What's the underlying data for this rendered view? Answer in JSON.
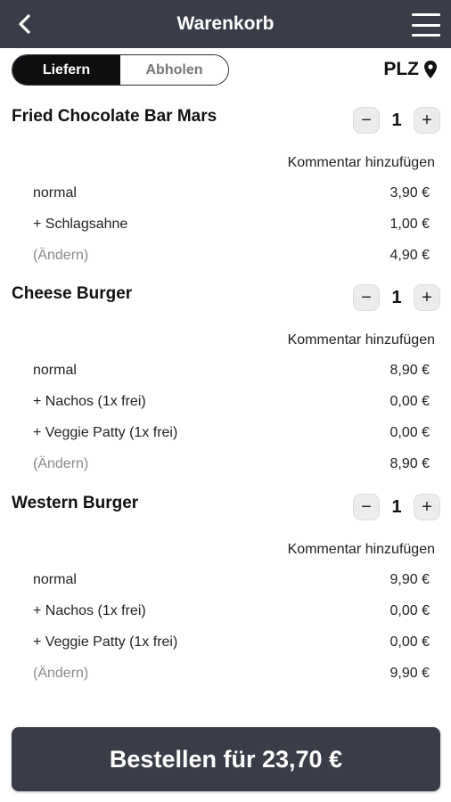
{
  "header": {
    "title": "Warenkorb",
    "back_icon": "chevron-left-icon",
    "menu_icon": "hamburger-menu-icon"
  },
  "delivery_toggle": {
    "options": [
      "Liefern",
      "Abholen"
    ],
    "selected": "Liefern"
  },
  "plz": {
    "label": "PLZ",
    "icon": "location-pin-icon"
  },
  "items": [
    {
      "name": "Fried Chocolate Bar Mars",
      "quantity": "1",
      "comment_label": "Kommentar hinzufügen",
      "lines": [
        {
          "label": "normal",
          "price": "3,90 €"
        },
        {
          "label": "+ Schlagsahne",
          "price": "1,00 €"
        },
        {
          "label": "(Ändern)",
          "price": "4,90 €"
        }
      ]
    },
    {
      "name": "Cheese Burger",
      "quantity": "1",
      "comment_label": "Kommentar hinzufügen",
      "lines": [
        {
          "label": "normal",
          "price": "8,90 €"
        },
        {
          "label": "+ Nachos (1x frei)",
          "price": "0,00 €"
        },
        {
          "label": "+ Veggie Patty (1x frei)",
          "price": "0,00 €"
        },
        {
          "label": "(Ändern)",
          "price": "8,90 €"
        }
      ]
    },
    {
      "name": "Western Burger",
      "quantity": "1",
      "comment_label": "Kommentar hinzufügen",
      "lines": [
        {
          "label": "normal",
          "price": "9,90 €"
        },
        {
          "label": "+ Nachos (1x frei)",
          "price": "0,00 €"
        },
        {
          "label": "+ Veggie Patty (1x frei)",
          "price": "0,00 €"
        },
        {
          "label": "(Ändern)",
          "price": "9,90 €"
        }
      ]
    }
  ],
  "order_button": {
    "label": "Bestellen für 23,70 €"
  },
  "colors": {
    "header_bg": "#3a3d47",
    "toggle_active_bg": "#0e0e10",
    "stepper_bg": "#ececec"
  }
}
